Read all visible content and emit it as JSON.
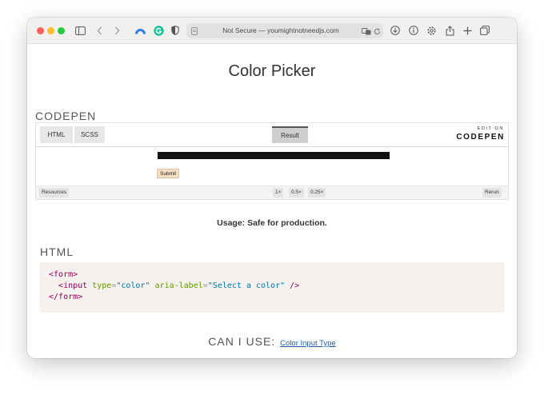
{
  "browser": {
    "address_text": "Not Secure — youmightnotneedjs.com",
    "traffic_colors": {
      "close": "#ff5f57",
      "minimize": "#febc2e",
      "maximize": "#28c840"
    }
  },
  "page": {
    "title": "Color Picker",
    "codepen_label": "CODEPEN",
    "embed": {
      "tabs": [
        "HTML",
        "SCSS"
      ],
      "result_tab": "Result",
      "edit_on": "EDIT ON",
      "logo": "CODEPEN",
      "submit_label": "Submit",
      "resources_label": "Resources",
      "zoom_options": [
        "1×",
        "0.5×",
        "0.25×"
      ],
      "rerun_label": "Rerun"
    },
    "usage": "Usage: Safe for production.",
    "html_heading": "HTML",
    "code": {
      "l1_tag": "form",
      "l2_tag": "input",
      "l2_attr1": "type",
      "l2_val1": "\"color\"",
      "l2_attr2": "aria-label",
      "l2_val2": "\"Select a color\"",
      "l3_tag": "form"
    },
    "caniuse_label": "CAN I USE:",
    "caniuse_link": "Color Input Type"
  },
  "icons": [
    "sidebar-icon",
    "back-icon",
    "forward-icon",
    "arc-icon",
    "grammarly-icon",
    "shield-icon",
    "page-icon",
    "translate-icon",
    "reload-icon",
    "download-icon",
    "info-icon",
    "gear-icon",
    "share-icon",
    "new-tab-icon",
    "tabs-overview-icon"
  ]
}
